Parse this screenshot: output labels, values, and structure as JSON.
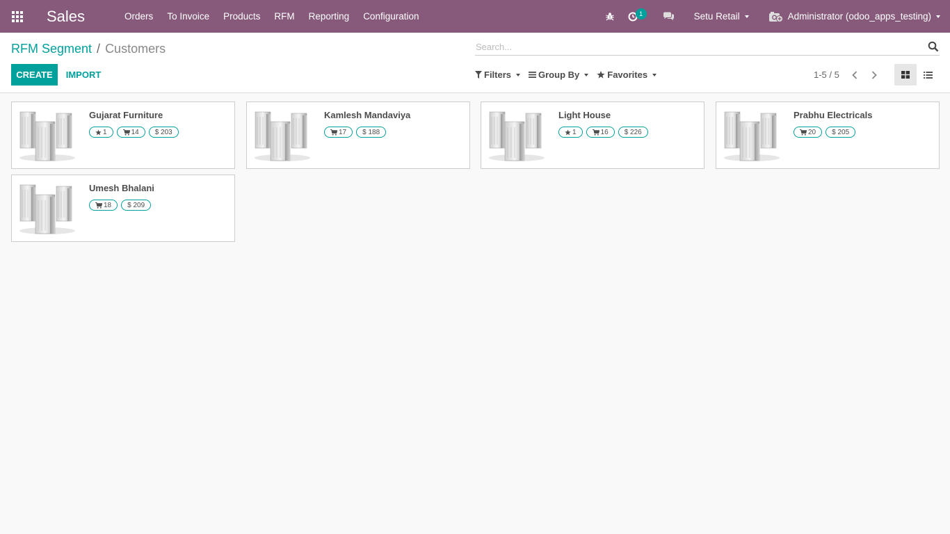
{
  "navbar": {
    "app_title": "Sales",
    "menu": [
      "Orders",
      "To Invoice",
      "Products",
      "RFM",
      "Reporting",
      "Configuration"
    ],
    "activity_count": "1",
    "company": "Setu Retail",
    "user": "Administrator (odoo_apps_testing)"
  },
  "breadcrumb": {
    "parent": "RFM Segment",
    "separator": "/",
    "current": "Customers"
  },
  "search": {
    "placeholder": "Search..."
  },
  "buttons": {
    "create": "CREATE",
    "import": "IMPORT"
  },
  "search_options": {
    "filters": "Filters",
    "group_by": "Group By",
    "favorites": "Favorites"
  },
  "pager": {
    "value": "1-5 / 5"
  },
  "customers": [
    {
      "name": "Gujarat Furniture",
      "badges": [
        {
          "icon": "star-icon",
          "value": "1"
        },
        {
          "icon": "cart-icon",
          "value": "14"
        },
        {
          "icon": "dollar-icon",
          "value": "$ 203"
        }
      ]
    },
    {
      "name": "Kamlesh Mandaviya",
      "badges": [
        {
          "icon": "cart-icon",
          "value": "17"
        },
        {
          "icon": "dollar-icon",
          "value": "$ 188"
        }
      ]
    },
    {
      "name": "Light House",
      "badges": [
        {
          "icon": "star-icon",
          "value": "1"
        },
        {
          "icon": "cart-icon",
          "value": "16"
        },
        {
          "icon": "dollar-icon",
          "value": "$ 226"
        }
      ]
    },
    {
      "name": "Prabhu Electricals",
      "badges": [
        {
          "icon": "cart-icon",
          "value": "20"
        },
        {
          "icon": "dollar-icon",
          "value": "$ 205"
        }
      ]
    },
    {
      "name": "Umesh Bhalani",
      "badges": [
        {
          "icon": "cart-icon",
          "value": "18"
        },
        {
          "icon": "dollar-icon",
          "value": "$ 209"
        }
      ]
    }
  ],
  "colors": {
    "navbar": "#875a7b",
    "accent": "#00a09d"
  }
}
